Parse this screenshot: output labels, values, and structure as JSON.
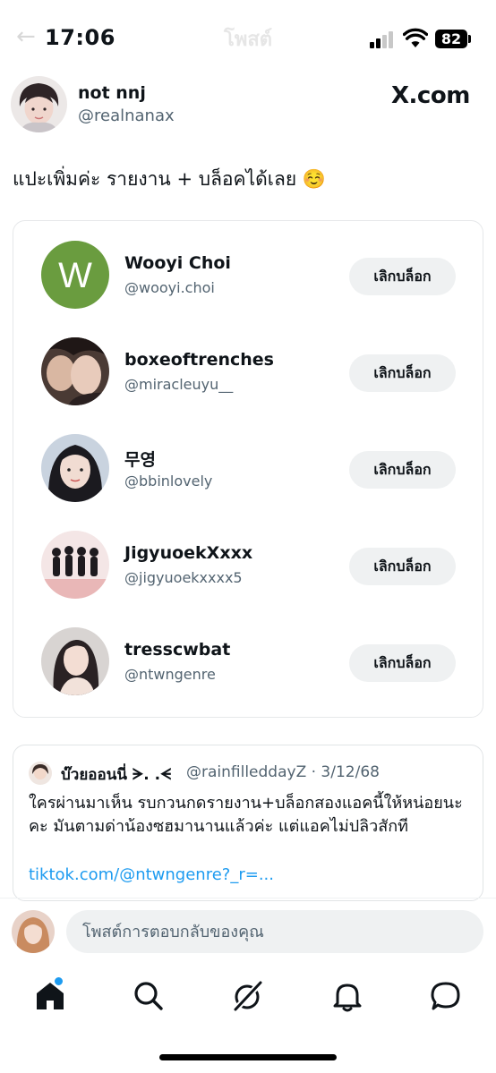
{
  "status_bar": {
    "time": "17:06",
    "battery": "82",
    "faded_title": "โพสต์"
  },
  "post": {
    "author_name": "not nnj",
    "author_handle": "@realnanax",
    "source_badge": "X.com",
    "text": "แปะเพิ่มค่ะ รายงาน + บล็อคได้เลย ☺️"
  },
  "blocked_list": {
    "unblock_label": "เลิกบล็อก",
    "users": [
      {
        "name": "Wooyi Choi",
        "handle": "@wooyi.choi",
        "initial": "W"
      },
      {
        "name": "boxeoftrenches",
        "handle": "@miracleuyu__"
      },
      {
        "name": "무영",
        "handle": "@bbinlovely"
      },
      {
        "name": "JigyuoekXxxx",
        "handle": "@jigyuoekxxxx5"
      },
      {
        "name": "tresscwbat",
        "handle": "@ntwngenre"
      }
    ]
  },
  "quoted_post": {
    "author_name": "บ๊วยออนนี่ ᗒ. .ᗕ",
    "meta": "@rainfilleddayZ · 3/12/68",
    "body": "ใครผ่านมาเห็น รบกวนกดรายงาน+บล็อกสองแอคนี้ให้หน่อยนะคะ มันตามด่าน้องซฮมานานแล้วค่ะ แต่แอคไม่ปลิวสักที",
    "link": "tiktok.com/@ntwngenre?_r=..."
  },
  "reply": {
    "placeholder": "โพสต์การตอบกลับของคุณ"
  },
  "nav": {
    "items": [
      "home-icon",
      "search-icon",
      "grok-icon",
      "notifications-icon",
      "messages-icon"
    ],
    "home_has_badge": true
  },
  "colors": {
    "accent": "#1d9bf0",
    "avatar_w": "#6a9c3f",
    "button_bg": "#eff1f2",
    "secondary_text": "#536471"
  }
}
